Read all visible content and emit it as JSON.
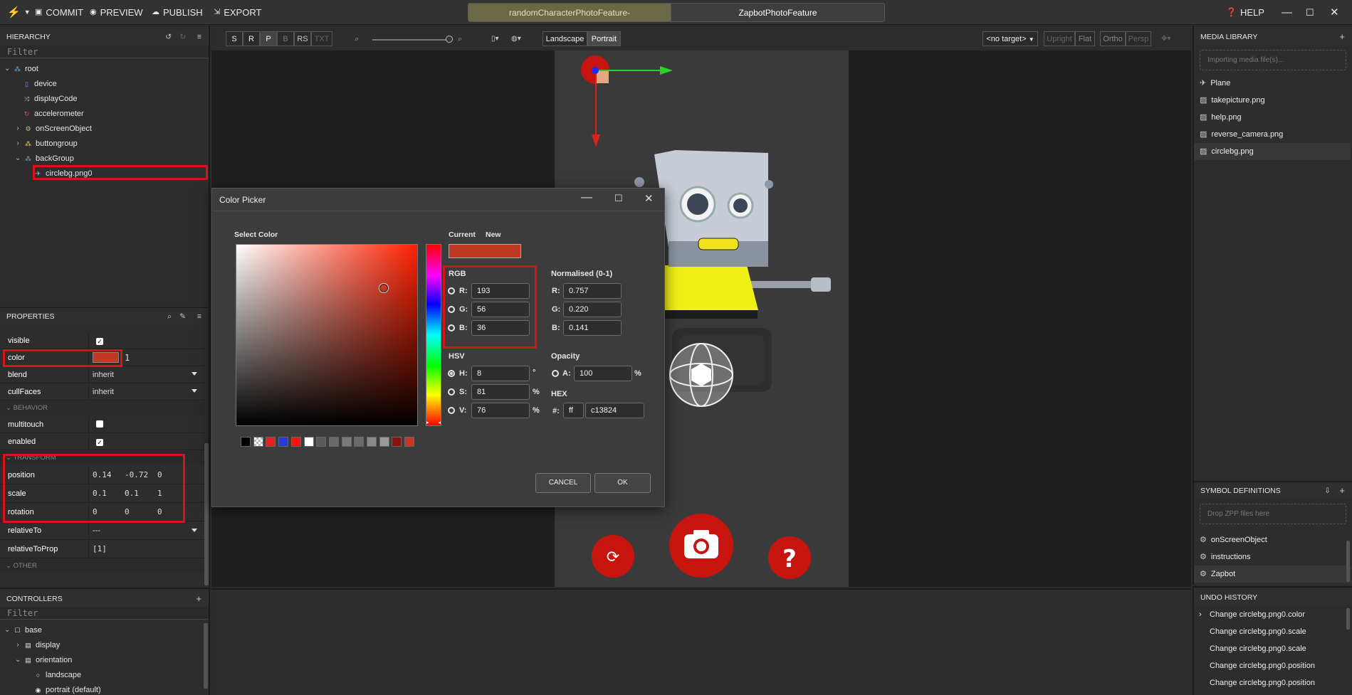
{
  "toolbar": {
    "commit": "COMMIT",
    "preview": "PREVIEW",
    "publish": "PUBLISH",
    "export": "EXPORT",
    "help": "HELP"
  },
  "tabs": [
    {
      "label": "randomCharacterPhotoFeature-",
      "active": false
    },
    {
      "label": "ZapbotPhotoFeature",
      "active": true
    }
  ],
  "hierarchy": {
    "title": "HIERARCHY",
    "filter_placeholder": "Filter",
    "items": [
      {
        "label": "root",
        "icon": "group-icon"
      },
      {
        "label": "device",
        "icon": "device-icon"
      },
      {
        "label": "displayCode",
        "icon": "shuffle-icon"
      },
      {
        "label": "accelerometer",
        "icon": "accelerometer-icon"
      },
      {
        "label": "onScreenObject",
        "icon": "gear-icon"
      },
      {
        "label": "buttongroup",
        "icon": "group-icon"
      },
      {
        "label": "backGroup",
        "icon": "group-icon"
      },
      {
        "label": "circlebg.png0",
        "icon": "image-node-icon"
      }
    ]
  },
  "properties": {
    "title": "PROPERTIES",
    "visible_label": "visible",
    "color_label": "color",
    "color_value": "#c13824",
    "color_alpha": "1",
    "blend_label": "blend",
    "blend_value": "inherit",
    "cullfaces_label": "cullFaces",
    "cullfaces_value": "inherit",
    "behavior_section": "BEHAVIOR",
    "multitouch_label": "multitouch",
    "enabled_label": "enabled",
    "transform_section": "TRANSFORM",
    "position_label": "position",
    "position": [
      "0.14",
      "-0.72",
      "0"
    ],
    "scale_label": "scale",
    "scale": [
      "0.1",
      "0.1",
      "1"
    ],
    "rotation_label": "rotation",
    "rotation": [
      "0",
      "0",
      "0"
    ],
    "relativeto_label": "relativeTo",
    "relativeto_value": "---",
    "relativetoprop_label": "relativeToProp",
    "relativetoprop_value": "[1]",
    "other_section": "OTHER"
  },
  "controllers": {
    "title": "CONTROLLERS",
    "filter_placeholder": "Filter",
    "items": [
      {
        "label": "base"
      },
      {
        "label": "display"
      },
      {
        "label": "orientation"
      },
      {
        "label": "landscape"
      },
      {
        "label": "portrait (default)"
      }
    ]
  },
  "viewport_toolbar": {
    "modes": [
      "S",
      "R",
      "P",
      "B",
      "RS",
      "TXT"
    ],
    "landscape": "Landscape",
    "portrait": "Portrait",
    "target": "<no target>",
    "upright": "Upright",
    "flat": "Flat",
    "ortho": "Ortho",
    "persp": "Persp"
  },
  "media_library": {
    "title": "MEDIA LIBRARY",
    "import_status": "Importing media file(s)...",
    "items": [
      "Plane",
      "takepicture.png",
      "help.png",
      "reverse_camera.png",
      "circlebg.png"
    ]
  },
  "symbol_definitions": {
    "title": "SYMBOL DEFINITIONS",
    "drop_hint": "Drop ZPP files here",
    "items": [
      "onScreenObject",
      "instructions",
      "Zapbot"
    ]
  },
  "undo_history": {
    "title": "UNDO HISTORY",
    "items": [
      "Change circlebg.png0.color",
      "Change circlebg.png0.scale",
      "Change circlebg.png0.scale",
      "Change circlebg.png0.position",
      "Change circlebg.png0.position"
    ]
  },
  "color_picker": {
    "title": "Color Picker",
    "select_color": "Select Color",
    "current_label": "Current",
    "new_label": "New",
    "current_color": "#c13824",
    "new_color": "#c13824",
    "rgb_label": "RGB",
    "r_label": "R:",
    "r": "193",
    "g_label": "G:",
    "g": "56",
    "b_label": "B:",
    "b": "36",
    "normalised_label": "Normalised (0-1)",
    "nr": "0.757",
    "ng": "0.220",
    "nb": "0.141",
    "hsv_label": "HSV",
    "h_label": "H:",
    "h": "8",
    "h_unit": "°",
    "s_label": "S:",
    "s": "81",
    "s_unit": "%",
    "v_label": "V:",
    "v": "76",
    "v_unit": "%",
    "opacity_label": "Opacity",
    "a_label": "A:",
    "a": "100",
    "a_unit": "%",
    "hex_label": "HEX",
    "hash_label": "#:",
    "hex_alpha": "ff",
    "hex": "c13824",
    "cancel": "CANCEL",
    "ok": "OK",
    "swatches": [
      "#000000",
      "checker",
      "#e52020",
      "#2a3ad0",
      "#ff1010",
      "#ffffff",
      "#5a5a5a",
      "#6a6a6a",
      "#7a7a7a",
      "#6a6a6a",
      "#8a8a8a",
      "#9a9a9a",
      "#8a1010",
      "#c13824"
    ]
  },
  "colors": {
    "accent_red": "#d7121a",
    "robot_yellow": "#f0f018",
    "button_red": "#c8140f"
  }
}
